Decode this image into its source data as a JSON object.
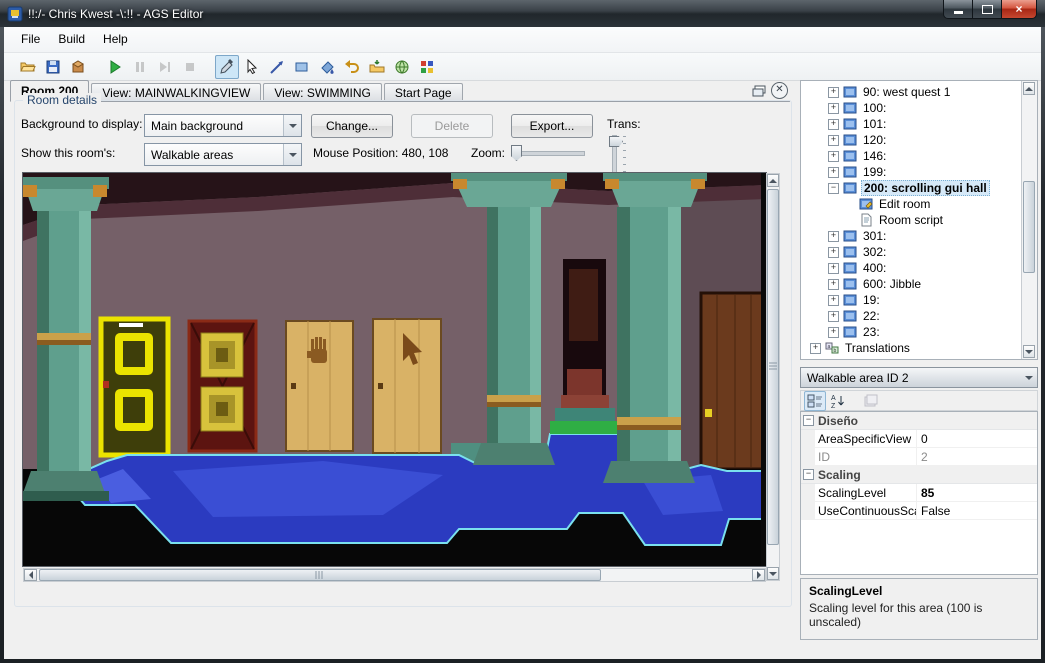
{
  "window": {
    "title": "!!:/- Chris Kwest -\\:!! - AGS Editor"
  },
  "menu": {
    "items": [
      "File",
      "Build",
      "Help"
    ]
  },
  "toolbar": {
    "buttons": [
      {
        "name": "open",
        "icon": "open-folder-icon"
      },
      {
        "name": "save",
        "icon": "save-icon"
      },
      {
        "name": "build-package",
        "icon": "package-icon"
      },
      {
        "name": "run",
        "icon": "run-icon"
      },
      {
        "name": "pause",
        "icon": "pause-icon",
        "disabled": true
      },
      {
        "name": "step",
        "icon": "step-icon",
        "disabled": true
      },
      {
        "name": "stop",
        "icon": "stop-icon",
        "disabled": true
      },
      {
        "name": "select-color",
        "icon": "eyedropper-icon",
        "selected": true
      },
      {
        "name": "select-cursor",
        "icon": "cursor-icon"
      },
      {
        "name": "draw-line",
        "icon": "line-icon"
      },
      {
        "name": "draw-rectangle",
        "icon": "rectangle-icon"
      },
      {
        "name": "fill-area",
        "icon": "fill-icon"
      },
      {
        "name": "undo",
        "icon": "undo-icon"
      },
      {
        "name": "import",
        "icon": "import-folder-icon"
      },
      {
        "name": "web",
        "icon": "globe-icon"
      },
      {
        "name": "palette",
        "icon": "palette-icon"
      }
    ]
  },
  "tabs": {
    "items": [
      {
        "label": "Room 200",
        "active": true
      },
      {
        "label": "View: MAINWALKINGVIEW",
        "active": false
      },
      {
        "label": "View: SWIMMING",
        "active": false
      },
      {
        "label": "Start Page",
        "active": false
      }
    ]
  },
  "room_details": {
    "group_label": "Room details",
    "background_label": "Background to display:",
    "background_value": "Main background",
    "change_button": "Change...",
    "delete_button": "Delete",
    "export_button": "Export...",
    "trans_label": "Trans:",
    "show_label": "Show this room's:",
    "show_value": "Walkable areas",
    "mouse_position": "Mouse Position: 480, 108",
    "zoom_label": "Zoom:"
  },
  "tree": {
    "items": [
      {
        "label": "90: west quest 1",
        "level": 2,
        "expand": "plus",
        "icon": "room",
        "selected": false
      },
      {
        "label": "100:",
        "level": 2,
        "expand": "plus",
        "icon": "room",
        "selected": false
      },
      {
        "label": "101:",
        "level": 2,
        "expand": "plus",
        "icon": "room",
        "selected": false
      },
      {
        "label": "120:",
        "level": 2,
        "expand": "plus",
        "icon": "room",
        "selected": false
      },
      {
        "label": "146:",
        "level": 2,
        "expand": "plus",
        "icon": "room",
        "selected": false
      },
      {
        "label": "199:",
        "level": 2,
        "expand": "plus",
        "icon": "room",
        "selected": false
      },
      {
        "label": "200: scrolling gui hall",
        "level": 2,
        "expand": "minus",
        "icon": "room",
        "selected": true
      },
      {
        "label": "Edit room",
        "level": 3,
        "expand": null,
        "icon": "edit-room",
        "selected": false
      },
      {
        "label": "Room script",
        "level": 3,
        "expand": null,
        "icon": "script",
        "selected": false
      },
      {
        "label": "301:",
        "level": 2,
        "expand": "plus",
        "icon": "room",
        "selected": false
      },
      {
        "label": "302:",
        "level": 2,
        "expand": "plus",
        "icon": "room",
        "selected": false
      },
      {
        "label": "400:",
        "level": 2,
        "expand": "plus",
        "icon": "room",
        "selected": false
      },
      {
        "label": "600: Jibble",
        "level": 2,
        "expand": "plus",
        "icon": "room",
        "selected": false
      },
      {
        "label": "19:",
        "level": 2,
        "expand": "plus",
        "icon": "room",
        "selected": false
      },
      {
        "label": "22:",
        "level": 2,
        "expand": "plus",
        "icon": "room",
        "selected": false
      },
      {
        "label": "23:",
        "level": 2,
        "expand": "plus",
        "icon": "room",
        "selected": false
      },
      {
        "label": "Translations",
        "level": 1,
        "expand": "plus",
        "icon": "translations",
        "selected": false
      }
    ]
  },
  "walkable_selector": {
    "value": "Walkable area ID 2"
  },
  "property_grid": {
    "toolbar": [
      {
        "name": "categorized",
        "icon": "categorized-icon",
        "selected": true
      },
      {
        "name": "alphabetical",
        "icon": "az-sort-icon"
      },
      {
        "name": "property-pages",
        "icon": "property-pages-icon",
        "disabled": true
      }
    ],
    "rows": [
      {
        "type": "category",
        "label": "Diseño"
      },
      {
        "type": "prop",
        "name": "AreaSpecificView",
        "value": "0",
        "readonly": false,
        "modified": false
      },
      {
        "type": "prop",
        "name": "ID",
        "value": "2",
        "readonly": true,
        "modified": false
      },
      {
        "type": "category",
        "label": "Scaling"
      },
      {
        "type": "prop",
        "name": "ScalingLevel",
        "value": "85",
        "readonly": false,
        "modified": true
      },
      {
        "type": "prop",
        "name": "UseContinuousSca",
        "value": "False",
        "readonly": false,
        "modified": false
      }
    ],
    "help_title": "ScalingLevel",
    "help_text": "Scaling level for this area (100 is unscaled)"
  },
  "colors": {
    "walkable_blue": "#2b3bc0",
    "walkable_outline": "#7ae0ee",
    "door_yellow": "#ebe300",
    "column_teal": "#5f9f8d",
    "selection": "#d6e9f8"
  }
}
